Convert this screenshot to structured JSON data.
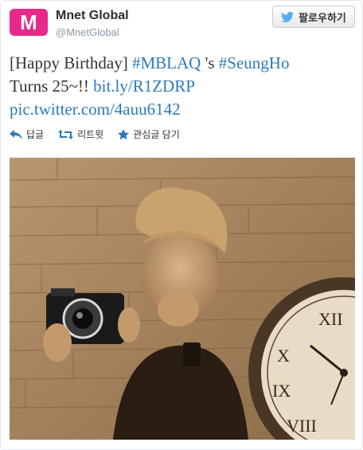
{
  "account": {
    "name": "Mnet Global",
    "handle": "@MnetGlobal",
    "avatar_text": "M"
  },
  "follow_button": {
    "label": "팔로우하기",
    "icon": "twitter-bird-icon"
  },
  "tweet": {
    "seg1": "[Happy Birthday] ",
    "tag1": "#MBLAQ",
    "seg2": " 's ",
    "tag2": "#SeungHo",
    "seg3": "Turns 25~!! ",
    "link1": "bit.ly/R1ZDRP",
    "link2": "pic.twitter.com/4auu6142"
  },
  "actions": {
    "reply": {
      "label": "답글",
      "icon": "reply-icon"
    },
    "retweet": {
      "label": "리트윗",
      "icon": "retweet-icon"
    },
    "favorite": {
      "label": "관심글 담기",
      "icon": "star-icon"
    }
  },
  "colors": {
    "brand": "#e52a8a",
    "link": "#2b7bb9",
    "text": "#333333",
    "muted": "#8899a6",
    "sepia": "#a98a62"
  }
}
